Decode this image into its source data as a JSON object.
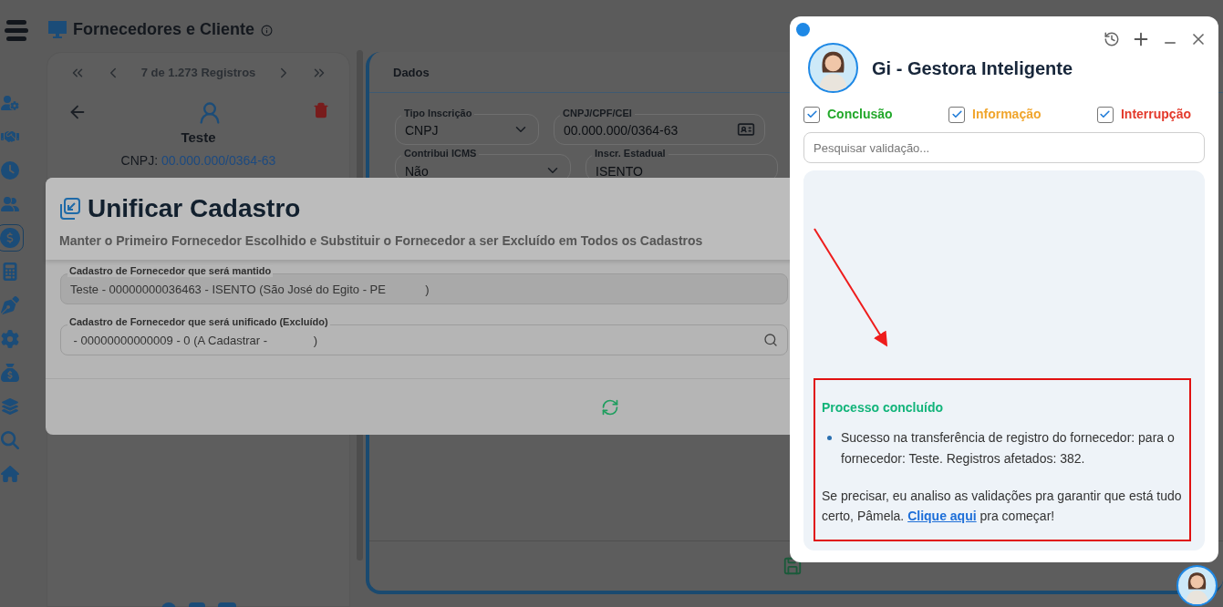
{
  "app": {
    "title": "Fornecedores e Cliente"
  },
  "sidebar": {
    "items": [
      {
        "selected": false
      },
      {
        "selected": false
      },
      {
        "selected": false
      },
      {
        "selected": false
      },
      {
        "selected": true
      },
      {
        "selected": false
      },
      {
        "selected": false
      },
      {
        "selected": false
      },
      {
        "selected": false
      },
      {
        "selected": false
      },
      {
        "selected": false
      },
      {
        "selected": false
      }
    ]
  },
  "record_panel": {
    "pager": "7 de 1.273 Registros",
    "name": "Teste",
    "cnpj_label": "CNPJ:",
    "cnpj": "00.000.000/0364-63"
  },
  "data_panel": {
    "title": "Dados",
    "fields": [
      {
        "label": "Tipo Inscrição",
        "value": "CNPJ",
        "kind": "select"
      },
      {
        "label": "CNPJ/CPF/CEI",
        "value": "00.000.000/0364-63",
        "kind": "document"
      },
      {
        "label": "Contribui ICMS",
        "value": "Não",
        "kind": "select"
      },
      {
        "label": "Inscr. Estadual",
        "value": "ISENTO",
        "kind": "text"
      }
    ]
  },
  "modal": {
    "title": "Unificar Cadastro",
    "subtitle": "Manter o Primeiro Fornecedor Escolhido e Substituir o Fornecedor a ser Excluído em Todos os Cadastros",
    "fields": [
      {
        "label": "Cadastro de Fornecedor que será mantido",
        "value": "Teste - 00000000036463 - ISENTO (São José do Egito - PE            )",
        "kind": "readonly"
      },
      {
        "label": "Cadastro de Fornecedor que será unificado (Excluído)",
        "value": " - 00000000000009 - 0 (A Cadastrar -              )",
        "kind": "search"
      }
    ]
  },
  "assistant": {
    "title": "Gi - Gestora Inteligente",
    "filters": [
      {
        "label": "Conclusão",
        "checked": true,
        "color": "#22a82a"
      },
      {
        "label": "Informação",
        "checked": true,
        "color": "#f0a52c"
      },
      {
        "label": "Interrupção",
        "checked": true,
        "color": "#e3392b"
      }
    ],
    "search": {
      "placeholder": "Pesquisar validação..."
    },
    "message": {
      "heading": "Processo concluído",
      "bullets": [
        "Sucesso na transferência de registro do fornecedor: para o fornecedor: Teste. Registros afetados: 382."
      ],
      "closing_before": "Se precisar, eu analiso as validações pra garantir que está tudo certo, Pâmela. ",
      "link": "Clique aqui",
      "closing_after": " pra começar!"
    }
  }
}
